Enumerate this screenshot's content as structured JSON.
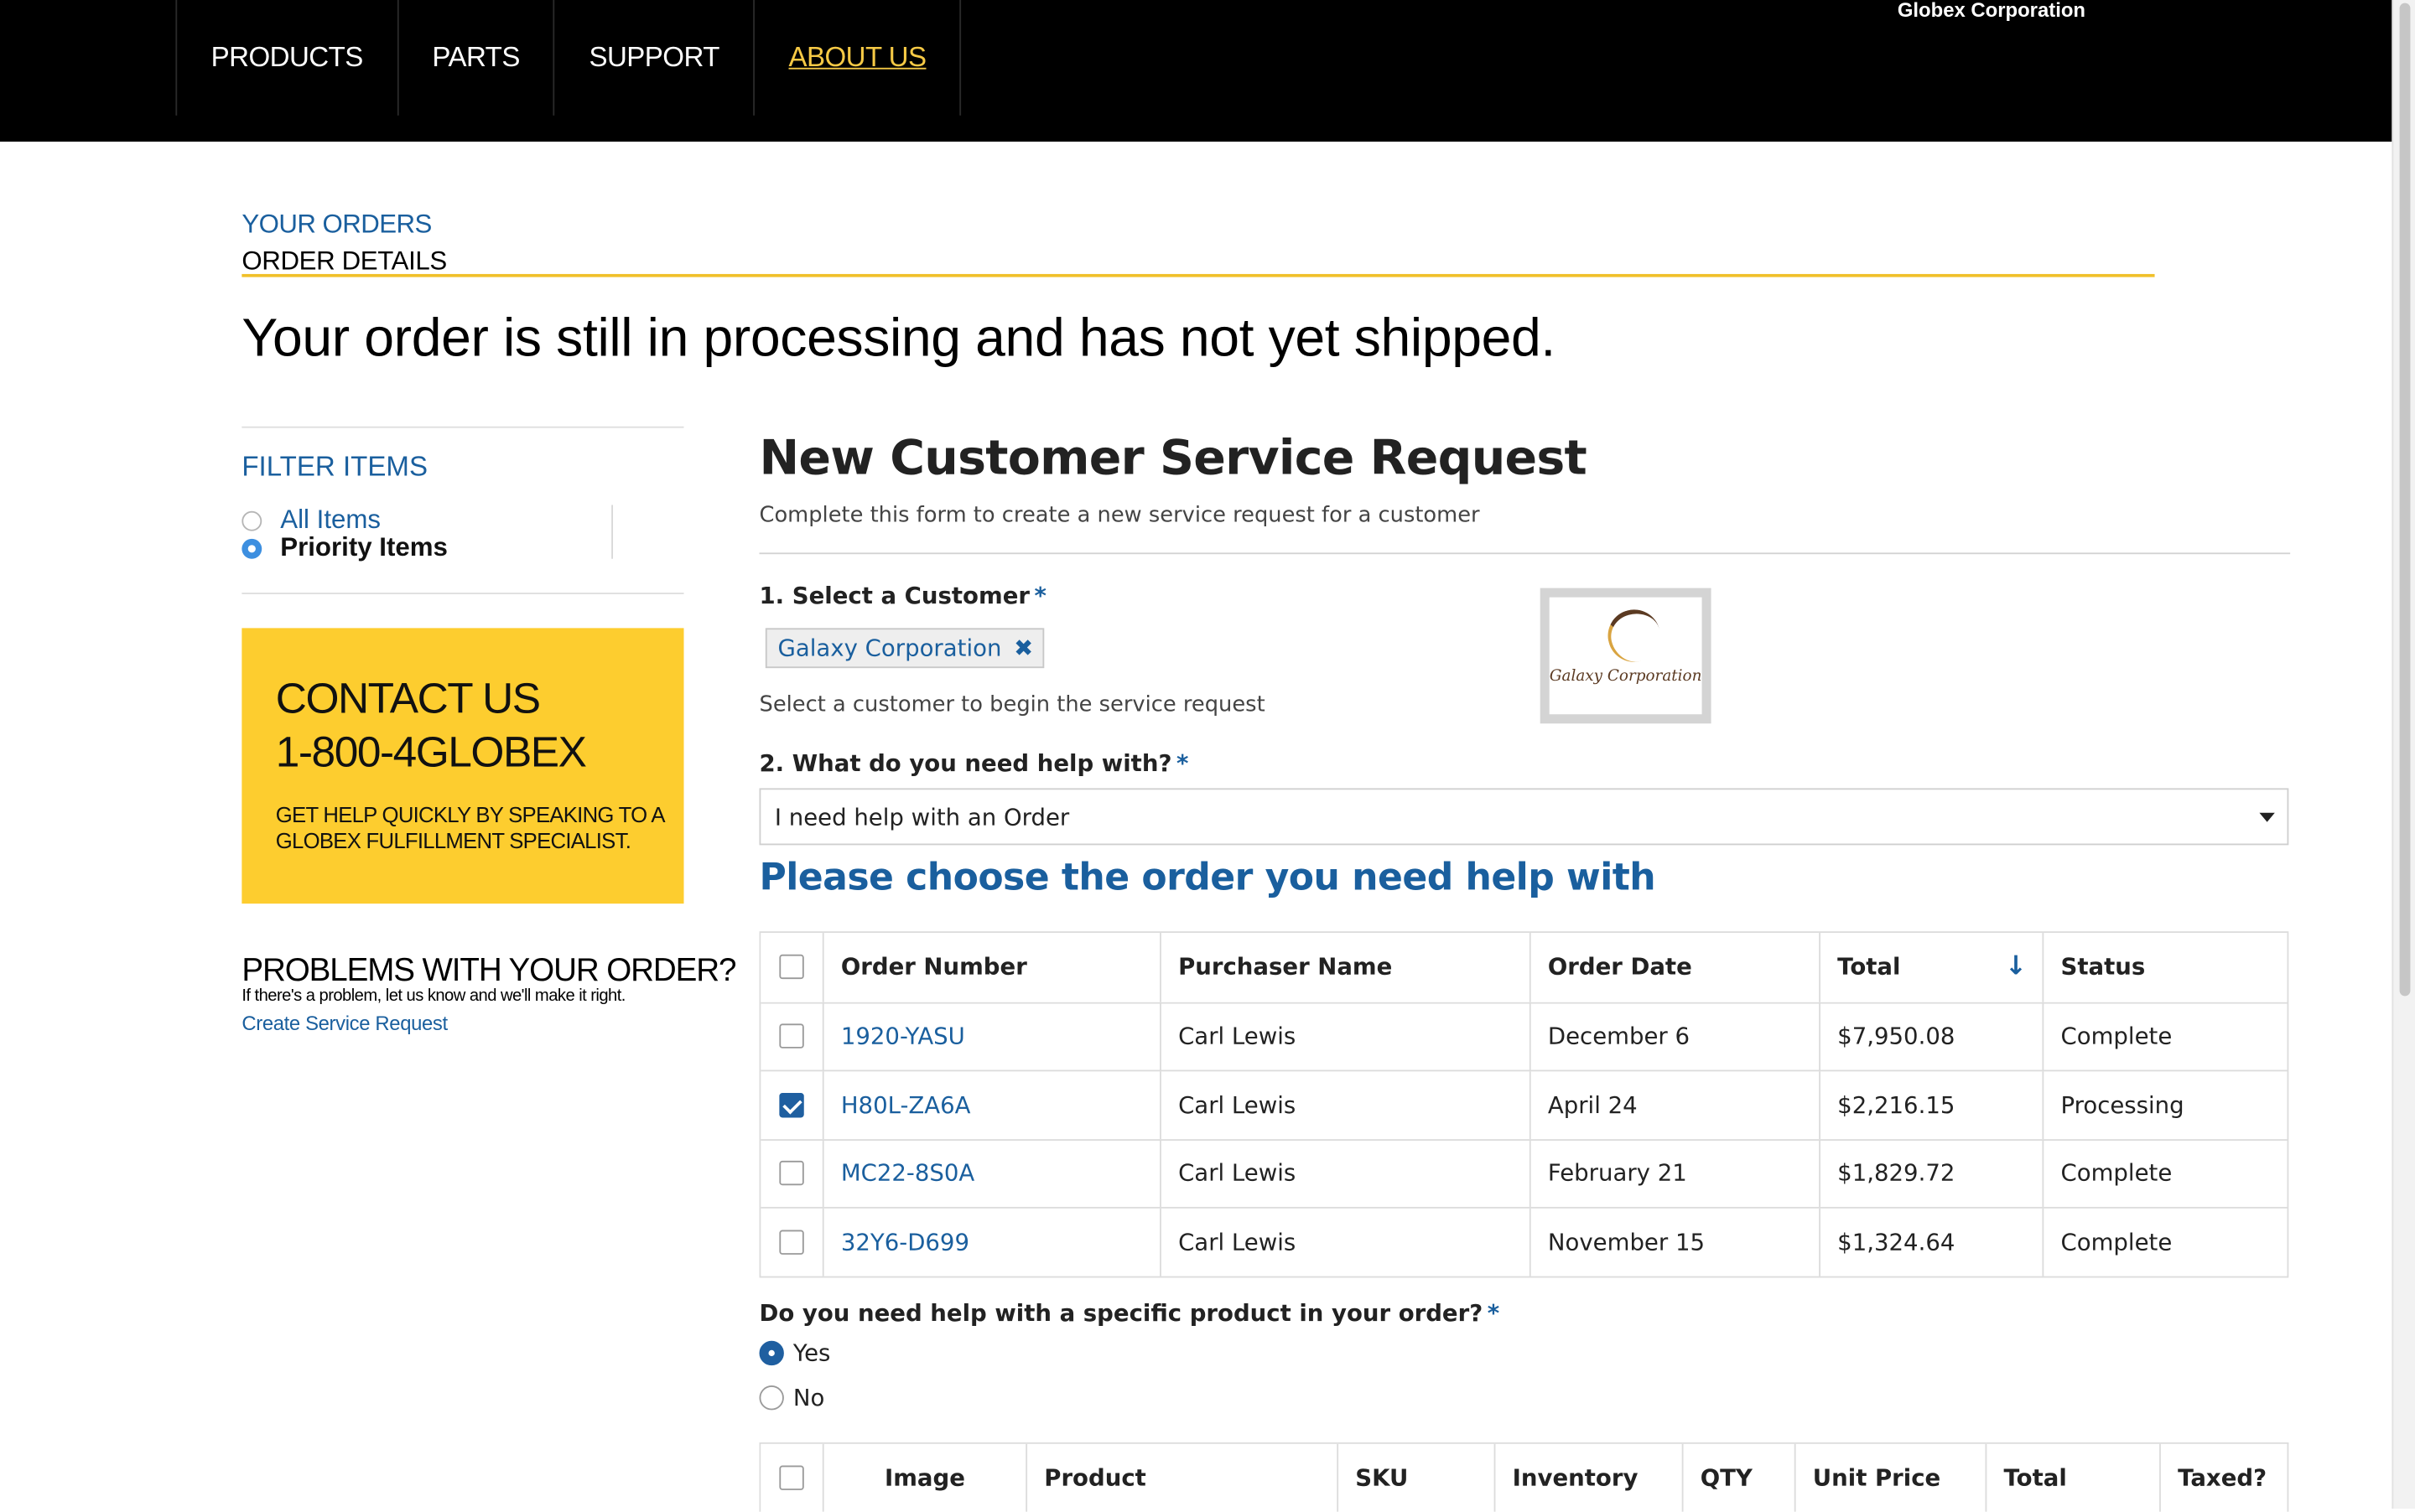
{
  "brand": "Globex Corporation",
  "nav": [
    {
      "label": "PRODUCTS",
      "active": false
    },
    {
      "label": "PARTS",
      "active": false
    },
    {
      "label": "SUPPORT",
      "active": false
    },
    {
      "label": "ABOUT US",
      "active": true
    }
  ],
  "breadcrumb": {
    "parent": "YOUR ORDERS",
    "current": "ORDER DETAILS"
  },
  "status_heading": "Your order is still in processing and has not yet shipped.",
  "filter": {
    "title": "FILTER ITEMS",
    "options": [
      {
        "label": "All Items",
        "selected": false
      },
      {
        "label": "Priority Items",
        "selected": true
      }
    ]
  },
  "contact": {
    "title": "CONTACT US",
    "phone": "1-800-4GLOBEX",
    "text": "GET HELP QUICKLY BY SPEAKING TO A GLOBEX FULFILLMENT SPECIALIST."
  },
  "problems": {
    "title": "PROBLEMS WITH YOUR ORDER?",
    "text": "If there's a problem, let us know and we'll make it right.",
    "link": "Create Service Request"
  },
  "form": {
    "title": "New Customer Service Request",
    "subtitle": "Complete this form to create a new service request for a customer",
    "q1": "1. Select a Customer",
    "required_mark": "*",
    "customer": "Galaxy Corporation",
    "customer_logo_text": "Galaxy Corporation",
    "customer_help": "Select a customer to begin the service request",
    "q2": "2. What do you need help with?",
    "help_topic": "I need help with an Order",
    "choose_heading": "Please choose the order you need help with",
    "specific_q": "Do you need help with a specific product in your order?",
    "specific_options": [
      {
        "label": "Yes",
        "selected": true
      },
      {
        "label": "No",
        "selected": false
      }
    ]
  },
  "orders": {
    "columns": [
      "Order Number",
      "Purchaser Name",
      "Order Date",
      "Total",
      "Status"
    ],
    "rows": [
      {
        "checked": false,
        "order": "1920-YASU",
        "purchaser": "Carl Lewis",
        "date": "December 6",
        "total": "$7,950.08",
        "status": "Complete"
      },
      {
        "checked": true,
        "order": "H80L-ZA6A",
        "purchaser": "Carl Lewis",
        "date": "April 24",
        "total": "$2,216.15",
        "status": "Processing"
      },
      {
        "checked": false,
        "order": "MC22-8S0A",
        "purchaser": "Carl Lewis",
        "date": "February 21",
        "total": "$1,829.72",
        "status": "Complete"
      },
      {
        "checked": false,
        "order": "32Y6-D699",
        "purchaser": "Carl Lewis",
        "date": "November 15",
        "total": "$1,324.64",
        "status": "Complete"
      }
    ]
  },
  "products": {
    "columns": [
      "Image",
      "Product",
      "SKU",
      "Inventory",
      "QTY",
      "Unit Price",
      "Total",
      "Taxed?"
    ]
  },
  "icons": {
    "sort": "sort-descending-arrow-icon",
    "remove": "remove-x-icon",
    "dropdown": "caret-down-icon"
  },
  "colors": {
    "link": "#1a5f9e",
    "accent_yellow": "#fdcd2f",
    "nav_bg": "#000000",
    "active_nav": "#f6c945"
  }
}
